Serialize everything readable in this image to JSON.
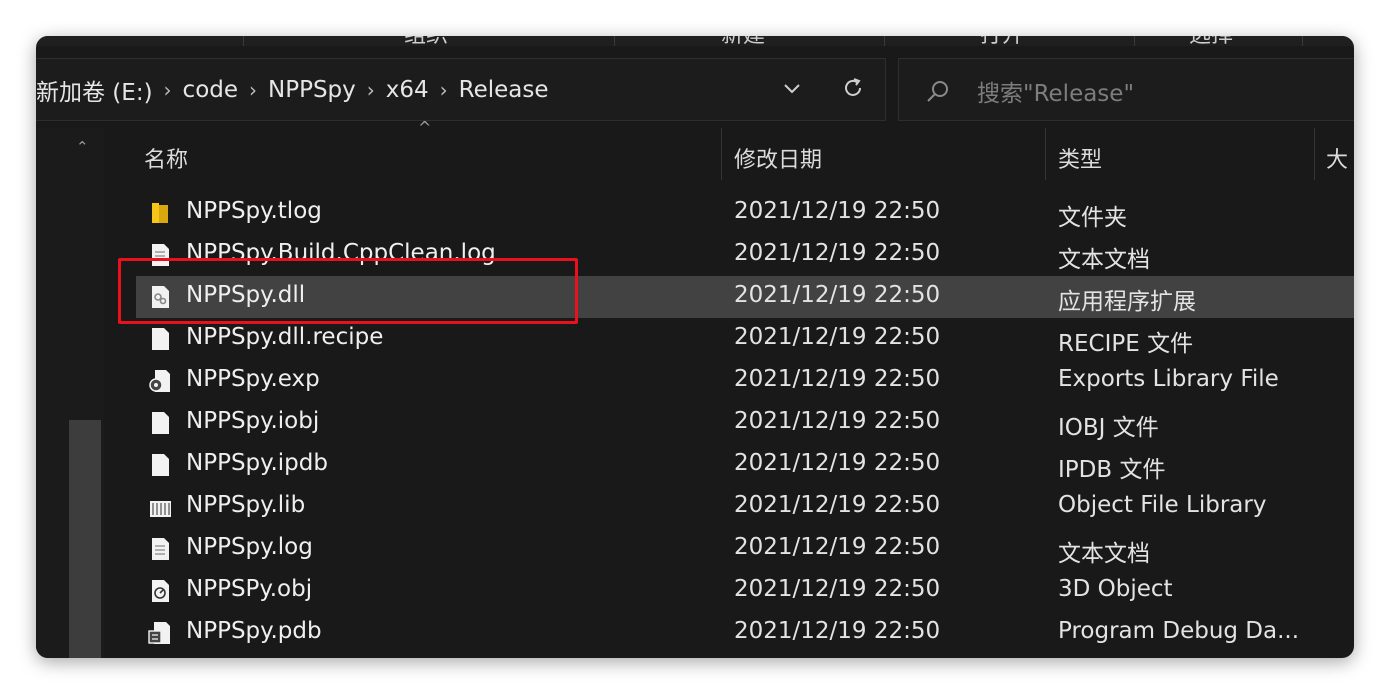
{
  "ribbon": {
    "groups": [
      "组织",
      "新建",
      "打开",
      "选择"
    ]
  },
  "address_bar": {
    "crumbs": [
      "新加卷 (E:)",
      "code",
      "NPPSpy",
      "x64",
      "Release"
    ]
  },
  "search": {
    "placeholder": "搜索\"Release\""
  },
  "columns": {
    "name": "名称",
    "date": "修改日期",
    "type": "类型",
    "size": "大"
  },
  "files": [
    {
      "name": "NPPSpy.tlog",
      "date": "2021/12/19 22:50",
      "type": "文件夹",
      "icon": "folder-icon"
    },
    {
      "name": "NPPSpy.Build.CppClean.log",
      "date": "2021/12/19 22:50",
      "type": "文本文档",
      "icon": "text-file-icon"
    },
    {
      "name": "NPPSpy.dll",
      "date": "2021/12/19 22:50",
      "type": "应用程序扩展",
      "icon": "dll-file-icon"
    },
    {
      "name": "NPPSpy.dll.recipe",
      "date": "2021/12/19 22:50",
      "type": "RECIPE 文件",
      "icon": "blank-file-icon"
    },
    {
      "name": "NPPSpy.exp",
      "date": "2021/12/19 22:50",
      "type": "Exports Library File",
      "icon": "exp-file-icon"
    },
    {
      "name": "NPPSpy.iobj",
      "date": "2021/12/19 22:50",
      "type": "IOBJ 文件",
      "icon": "blank-file-icon"
    },
    {
      "name": "NPPSpy.ipdb",
      "date": "2021/12/19 22:50",
      "type": "IPDB 文件",
      "icon": "blank-file-icon"
    },
    {
      "name": "NPPSpy.lib",
      "date": "2021/12/19 22:50",
      "type": "Object File Library",
      "icon": "lib-file-icon"
    },
    {
      "name": "NPPSpy.log",
      "date": "2021/12/19 22:50",
      "type": "文本文档",
      "icon": "text-file-icon"
    },
    {
      "name": "NPPSPy.obj",
      "date": "2021/12/19 22:50",
      "type": "3D Object",
      "icon": "obj-file-icon"
    },
    {
      "name": "NPPSpy.pdb",
      "date": "2021/12/19 22:50",
      "type": "Program Debug Da...",
      "icon": "pdb-file-icon"
    }
  ],
  "selected_index": 2,
  "colors": {
    "highlight": "#e8111c",
    "selected_row": "#424242",
    "background": "#191919"
  }
}
